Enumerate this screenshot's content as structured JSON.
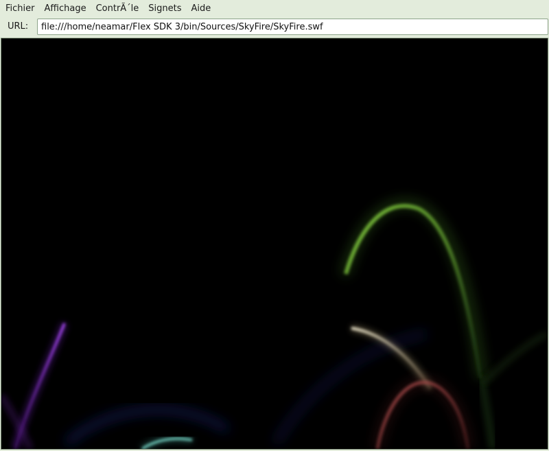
{
  "menubar": {
    "items": [
      {
        "label": "Fichier"
      },
      {
        "label": "Affichage"
      },
      {
        "label": "ContrÃ´le"
      },
      {
        "label": "Signets"
      },
      {
        "label": "Aide"
      }
    ]
  },
  "urlbar": {
    "label": "URL:",
    "value": "file:///home/neamar/Flex SDK 3/bin/Sources/SkyFire/SkyFire.swf"
  },
  "stage": {
    "background": "#000000",
    "fireworks": [
      {
        "name": "green",
        "color": "#6fae35"
      },
      {
        "name": "purple",
        "color": "#a040e0"
      },
      {
        "name": "beige",
        "color": "#d8d0b0"
      },
      {
        "name": "red",
        "color": "#b04a4a"
      },
      {
        "name": "teal",
        "color": "#6ed8c8"
      },
      {
        "name": "blue",
        "color": "#1a2a70"
      }
    ]
  }
}
